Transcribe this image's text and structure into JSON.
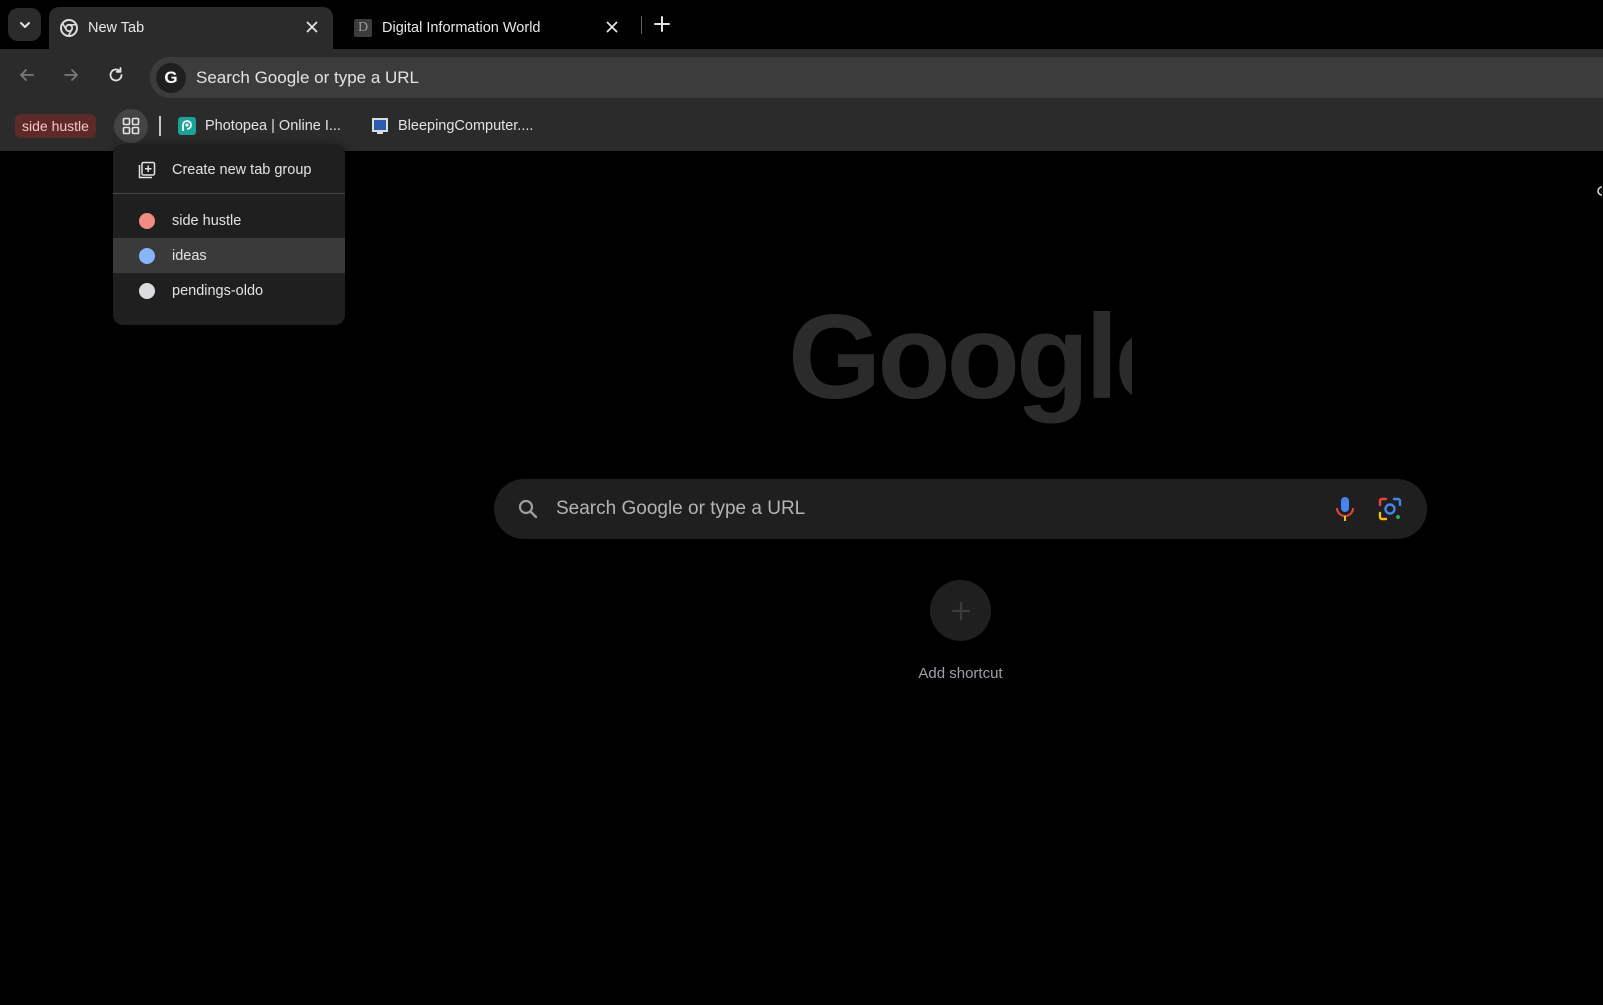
{
  "tabs": [
    {
      "title": "New Tab",
      "favicon": "chrome-icon",
      "active": true
    },
    {
      "title": "Digital Information World",
      "favicon": "letter-d-favicon",
      "favicon_letter": "D",
      "active": false
    }
  ],
  "toolbar": {
    "omnibox_text": "Search Google or type a URL",
    "omnibox_badge": "G"
  },
  "bookmarks": {
    "group_chip": {
      "label": "side hustle",
      "color": "#5c2b29"
    },
    "items": [
      {
        "label": "Photopea | Online I...",
        "icon": "photopea-icon"
      },
      {
        "label": "BleepingComputer....",
        "icon": "bleepingcomputer-icon"
      }
    ]
  },
  "groups_menu": {
    "create_label": "Create new tab group",
    "groups": [
      {
        "label": "side hustle",
        "color": "#f28b82"
      },
      {
        "label": "ideas",
        "color": "#8ab4f8"
      },
      {
        "label": "pendings-oldo",
        "color": "#dadce0"
      }
    ]
  },
  "ntp": {
    "logo_text": "Google",
    "search_placeholder": "Search Google or type a URL",
    "shortcut_label": "Add shortcut"
  },
  "colors": {
    "accent_blue": "#8ab4f8",
    "surface": "#2b2b2b",
    "background": "#000000"
  }
}
